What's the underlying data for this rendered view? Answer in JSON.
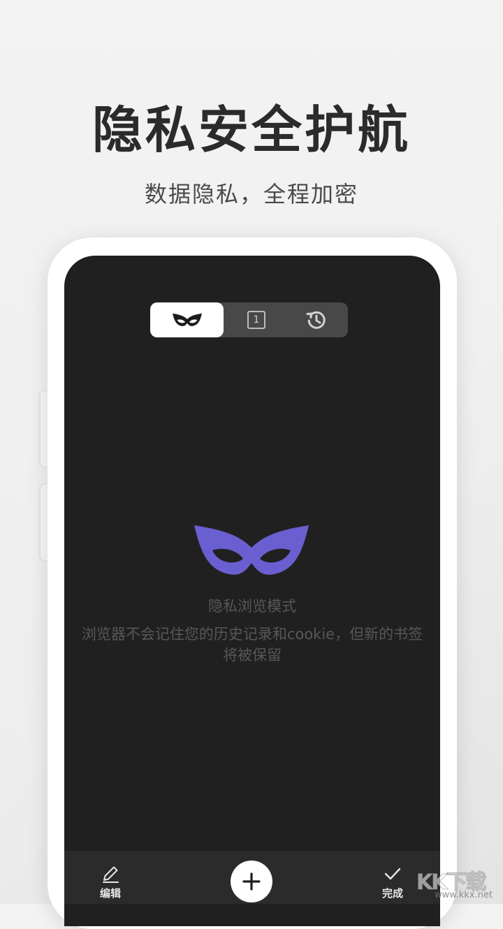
{
  "promo": {
    "headline": "隐私安全护航",
    "subheadline": "数据隐私，全程加密"
  },
  "tabs": [
    {
      "name": "private-mode",
      "icon": "mask-icon",
      "selected": true
    },
    {
      "name": "open-tabs",
      "icon": "tab-count-icon",
      "count_label": "1",
      "selected": false
    },
    {
      "name": "history",
      "icon": "history-icon",
      "selected": false
    }
  ],
  "empty_state": {
    "icon": "mask-icon",
    "title": "隐私浏览模式",
    "description": "浏览器不会记住您的历史记录和cookie，但新的书签将被保留"
  },
  "toolbar": {
    "edit_label": "编辑",
    "edit_icon": "pencil-icon",
    "add_icon": "plus-icon",
    "done_label": "完成",
    "done_icon": "check-icon"
  },
  "watermark": {
    "brand": "KK下载",
    "url": "www.kkx.net"
  },
  "colors": {
    "accent_mask": "#6a5fd0",
    "screen_bg": "#202020",
    "toolbar_bg": "#2b2b2b",
    "page_bg": "#f2f2f2"
  }
}
